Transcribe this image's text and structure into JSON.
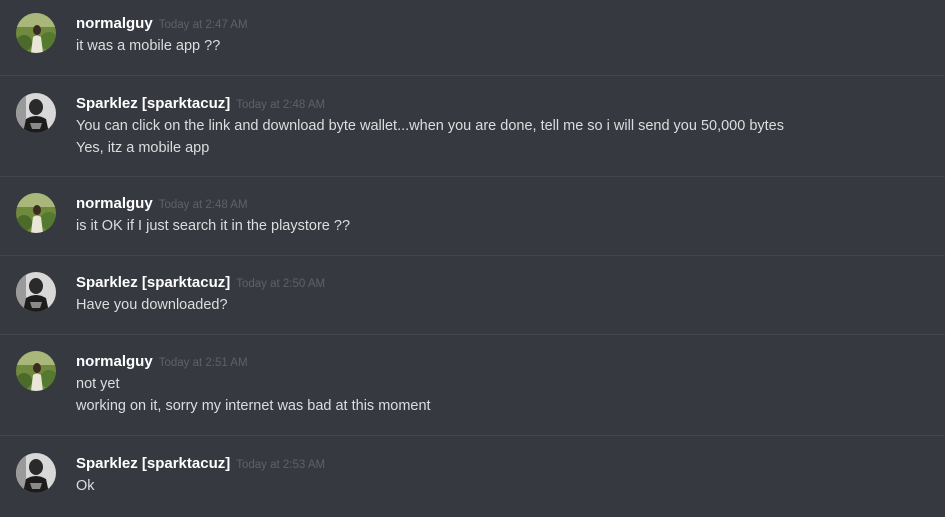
{
  "messages": [
    {
      "author": "normalguy",
      "avatar_icon": "green-field-person-avatar",
      "timestamp": "Today at 2:47 AM",
      "lines": [
        "it was a mobile app ??"
      ]
    },
    {
      "author": "Sparklez [sparktacuz]",
      "avatar_icon": "black-and-white-person-avatar",
      "timestamp": "Today at 2:48 AM",
      "lines": [
        "You can click on the link and download byte wallet...when you are done, tell me so i will send you 50,000 bytes",
        "Yes, itz a mobile app"
      ]
    },
    {
      "author": "normalguy",
      "avatar_icon": "green-field-person-avatar",
      "timestamp": "Today at 2:48 AM",
      "lines": [
        "is it OK if I just search it in the playstore ??"
      ]
    },
    {
      "author": "Sparklez [sparktacuz]",
      "avatar_icon": "black-and-white-person-avatar",
      "timestamp": "Today at 2:50 AM",
      "lines": [
        "Have you downloaded?"
      ]
    },
    {
      "author": "normalguy",
      "avatar_icon": "green-field-person-avatar",
      "timestamp": "Today at 2:51 AM",
      "lines": [
        "not yet",
        "working on it, sorry my internet was bad at this moment"
      ]
    },
    {
      "author": "Sparklez [sparktacuz]",
      "avatar_icon": "black-and-white-person-avatar",
      "timestamp": "Today at 2:53 AM",
      "lines": [
        "Ok"
      ]
    }
  ],
  "colors": {
    "background": "#36393f",
    "divider": "#42454a",
    "username": "#ffffff",
    "timestamp": "#5e6168",
    "message_text": "#dcddde"
  }
}
